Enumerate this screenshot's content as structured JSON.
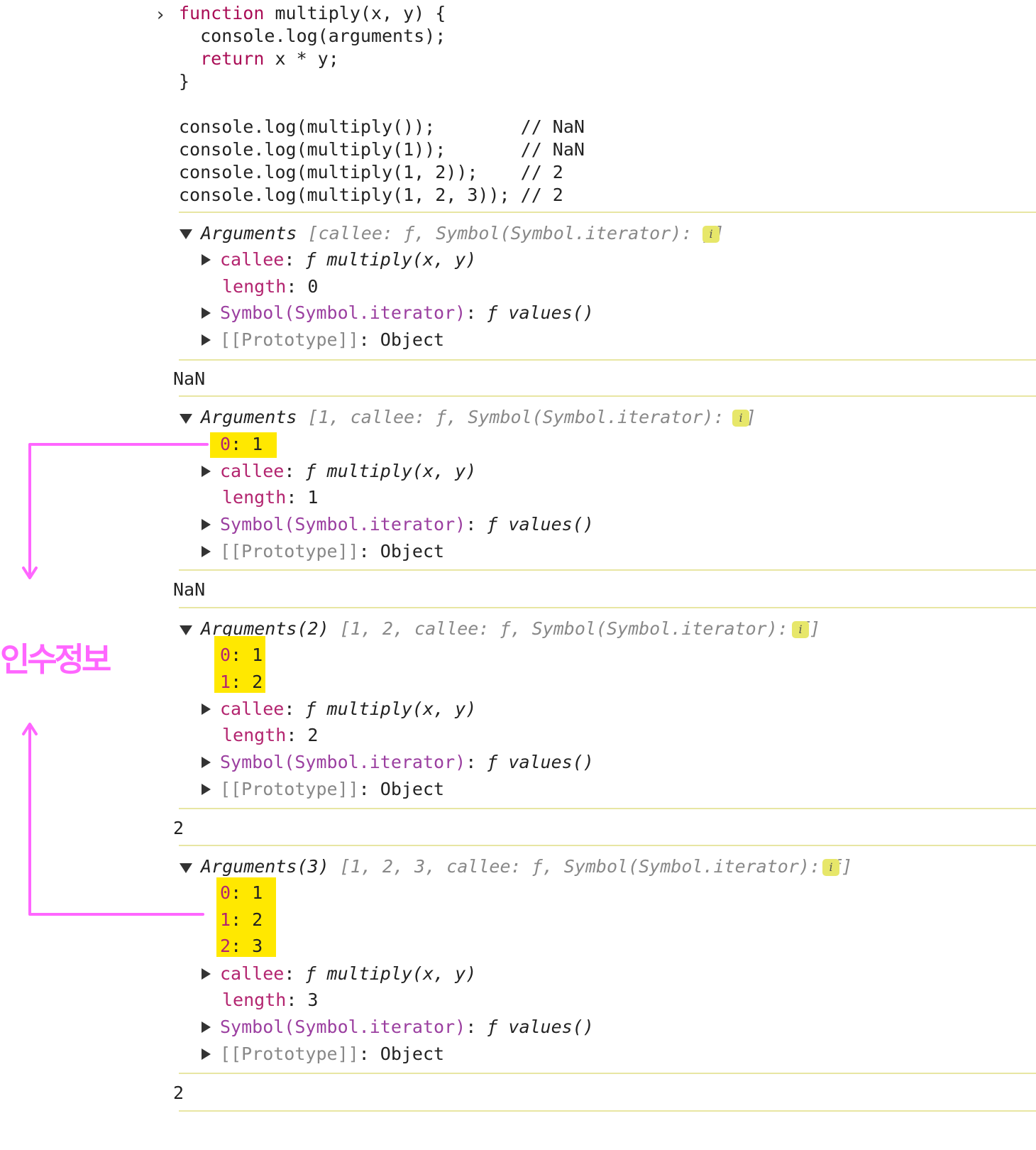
{
  "code": {
    "prompt_symbol": "›",
    "lines": [
      {
        "kw": "function",
        "rest": " multiply(x, y) {"
      },
      {
        "text": "  console.log(arguments);"
      },
      {
        "kw": "  return",
        "rest": " x * y;"
      },
      {
        "text": "}"
      },
      {
        "text": ""
      },
      {
        "text": "console.log(multiply());        // NaN"
      },
      {
        "text": "console.log(multiply(1));       // NaN"
      },
      {
        "text": "console.log(multiply(1, 2));    // 2"
      },
      {
        "text": "console.log(multiply(1, 2, 3)); // 2"
      }
    ]
  },
  "outputs": [
    {
      "header_prefix": "Arguments",
      "header_items": "[callee: ƒ, Symbol(Symbol.iterator): ƒ]",
      "indexed": [],
      "callee_key": "callee",
      "callee_val": "ƒ multiply(x, y)",
      "length_key": "length",
      "length_val": "0",
      "symbol_key": "Symbol(Symbol.iterator)",
      "symbol_val": "ƒ values()",
      "proto_key": "[[Prototype]]",
      "proto_val": "Object",
      "result": "NaN"
    },
    {
      "header_prefix": "Arguments",
      "header_items": "[1, callee: ƒ, Symbol(Symbol.iterator): ƒ]",
      "indexed": [
        {
          "k": "0",
          "v": "1"
        }
      ],
      "callee_key": "callee",
      "callee_val": "ƒ multiply(x, y)",
      "length_key": "length",
      "length_val": "1",
      "symbol_key": "Symbol(Symbol.iterator)",
      "symbol_val": "ƒ values()",
      "proto_key": "[[Prototype]]",
      "proto_val": "Object",
      "result": "NaN"
    },
    {
      "header_prefix": "Arguments(2)",
      "header_items": "[1, 2, callee: ƒ, Symbol(Symbol.iterator): ƒ]",
      "indexed": [
        {
          "k": "0",
          "v": "1"
        },
        {
          "k": "1",
          "v": "2"
        }
      ],
      "callee_key": "callee",
      "callee_val": "ƒ multiply(x, y)",
      "length_key": "length",
      "length_val": "2",
      "symbol_key": "Symbol(Symbol.iterator)",
      "symbol_val": "ƒ values()",
      "proto_key": "[[Prototype]]",
      "proto_val": "Object",
      "result": "2"
    },
    {
      "header_prefix": "Arguments(3)",
      "header_items": "[1, 2, 3, callee: ƒ, Symbol(Symbol.iterator): ƒ]",
      "indexed": [
        {
          "k": "0",
          "v": "1"
        },
        {
          "k": "1",
          "v": "2"
        },
        {
          "k": "2",
          "v": "3"
        }
      ],
      "callee_key": "callee",
      "callee_val": "ƒ multiply(x, y)",
      "length_key": "length",
      "length_val": "3",
      "symbol_key": "Symbol(Symbol.iterator)",
      "symbol_val": "ƒ values()",
      "proto_key": "[[Prototype]]",
      "proto_val": "Object",
      "result": "2"
    }
  ],
  "info_badge": "i",
  "annotation": {
    "label": "인수정보",
    "color": "#ff66ff",
    "highlight_color": "#ffe800"
  }
}
